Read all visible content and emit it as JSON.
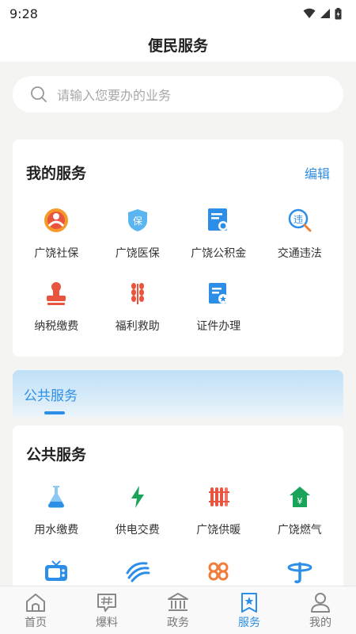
{
  "status": {
    "time": "9:28"
  },
  "header": {
    "title": "便民服务"
  },
  "search": {
    "placeholder": "请输入您要办的业务"
  },
  "my_services": {
    "title": "我的服务",
    "edit_label": "编辑",
    "items": [
      {
        "label": "广饶社保",
        "icon": "social-security-icon"
      },
      {
        "label": "广饶医保",
        "icon": "medical-insurance-icon"
      },
      {
        "label": "广饶公积金",
        "icon": "housing-fund-icon"
      },
      {
        "label": "交通违法",
        "icon": "traffic-violation-icon"
      },
      {
        "label": "纳税缴费",
        "icon": "tax-stamp-icon"
      },
      {
        "label": "福利救助",
        "icon": "welfare-icon"
      },
      {
        "label": "证件办理",
        "icon": "certificate-icon"
      }
    ]
  },
  "public_tab": {
    "label": "公共服务"
  },
  "public_services": {
    "title": "公共服务",
    "items": [
      {
        "label": "用水缴费",
        "icon": "water-flask-icon"
      },
      {
        "label": "供电交费",
        "icon": "lightning-icon"
      },
      {
        "label": "广饶供暖",
        "icon": "radiator-icon"
      },
      {
        "label": "广饶燃气",
        "icon": "gas-house-icon"
      },
      {
        "label": "",
        "icon": "tv-icon"
      },
      {
        "label": "",
        "icon": "china-mobile-icon"
      },
      {
        "label": "",
        "icon": "china-unicom-icon"
      },
      {
        "label": "",
        "icon": "china-telecom-icon"
      }
    ]
  },
  "bottom_nav": [
    {
      "label": "首页",
      "icon": "home-icon",
      "active": false
    },
    {
      "label": "爆料",
      "icon": "hashtag-chat-icon",
      "active": false
    },
    {
      "label": "政务",
      "icon": "government-building-icon",
      "active": false
    },
    {
      "label": "服务",
      "icon": "service-star-icon",
      "active": true
    },
    {
      "label": "我的",
      "icon": "profile-icon",
      "active": false
    }
  ],
  "colors": {
    "accent": "#2d8ee8",
    "orange": "#f07d3a",
    "red": "#e8543d",
    "green": "#1aa45a"
  }
}
